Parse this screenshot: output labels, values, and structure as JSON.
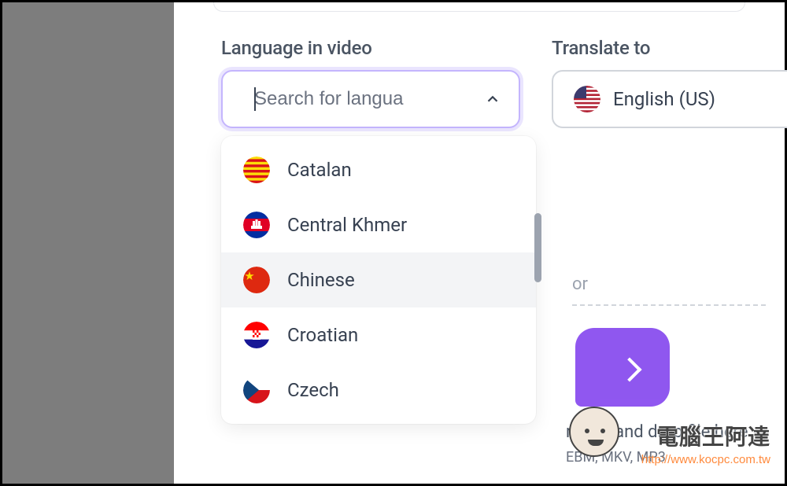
{
  "labels": {
    "language_in_video": "Language in video",
    "translate_to": "Translate to"
  },
  "search": {
    "placeholder": "Search for langua"
  },
  "translate_to_selected": "English (US)",
  "options": [
    {
      "name": "Catalan",
      "flag": "es-catalonia"
    },
    {
      "name": "Central Khmer",
      "flag": "kh"
    },
    {
      "name": "Chinese",
      "flag": "cn"
    },
    {
      "name": "Croatian",
      "flag": "hr"
    },
    {
      "name": "Czech",
      "flag": "cz"
    }
  ],
  "highlighted_index": 2,
  "background": {
    "or_label": "or",
    "drag_text": "r drag and drop file here",
    "formats": "EBM, MKV, MP3"
  },
  "watermark": {
    "text": "電腦王阿達",
    "url": "http://www.kocpc.com.tw"
  }
}
